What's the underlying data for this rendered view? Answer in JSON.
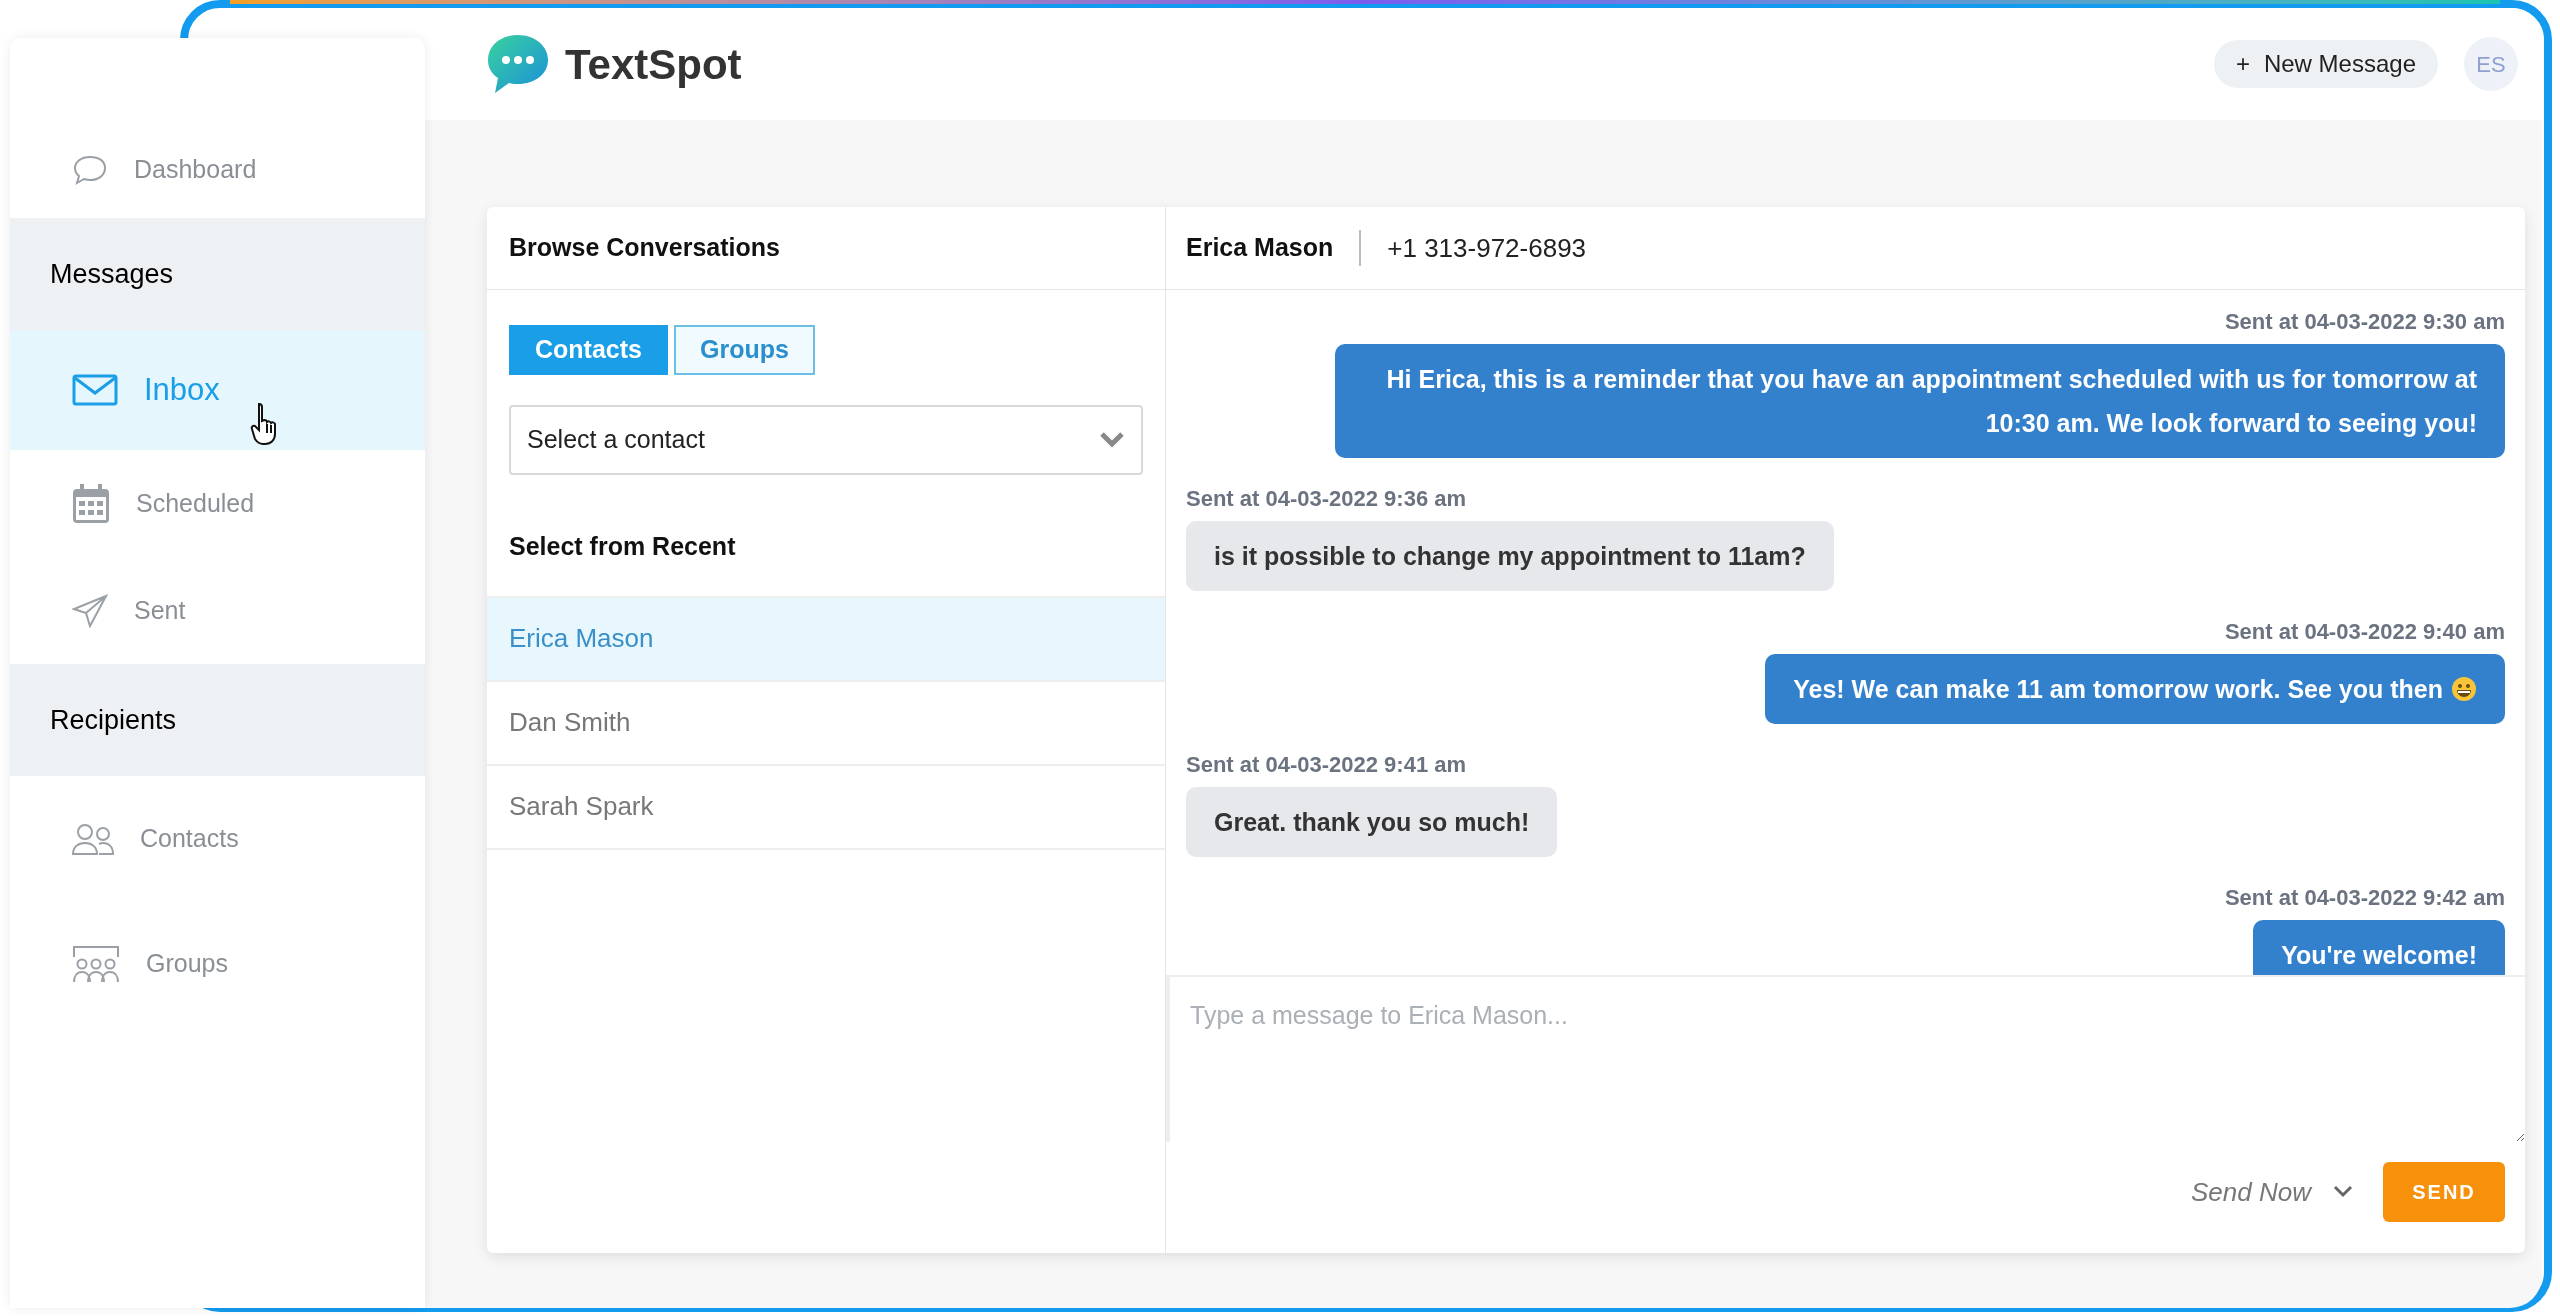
{
  "header": {
    "brand": "TextSpot",
    "new_message": {
      "icon": "+",
      "label": "New Message"
    },
    "avatar": "ES"
  },
  "sidebar": {
    "top_items": [
      {
        "label": "Dashboard",
        "selected": false
      }
    ],
    "sections": [
      {
        "title": "Messages",
        "items": [
          {
            "label": "Inbox",
            "selected": true
          },
          {
            "label": "Scheduled",
            "selected": false
          },
          {
            "label": "Sent",
            "selected": false
          }
        ]
      },
      {
        "title": "Recipients",
        "items": [
          {
            "label": "Contacts",
            "selected": false
          },
          {
            "label": "Groups",
            "selected": false
          }
        ]
      }
    ]
  },
  "conversations": {
    "title": "Browse Conversations",
    "tabs": [
      {
        "label": "Contacts",
        "selected": true
      },
      {
        "label": "Groups",
        "selected": false
      }
    ],
    "contact_select": {
      "placeholder": "Select a contact"
    },
    "recent_title": "Select from Recent",
    "recent": [
      {
        "name": "Erica Mason",
        "selected": true
      },
      {
        "name": "Dan Smith",
        "selected": false
      },
      {
        "name": "Sarah Spark",
        "selected": false
      }
    ]
  },
  "chat": {
    "contact_name": "Erica Mason",
    "phone": "+1 313-972-6893",
    "messages": [
      {
        "kind": "outgoing",
        "timestamp": "Sent at 04-03-2022 9:30 am",
        "text": "Hi Erica, this is a reminder that you have an appointment scheduled with us for tomorrow at 10:30 am. We look forward to seeing you!",
        "ends_with_emoji": false
      },
      {
        "kind": "incoming",
        "timestamp": "Sent at 04-03-2022 9:36 am",
        "text": "is it possible to change my appointment to 11am?",
        "ends_with_emoji": false
      },
      {
        "kind": "outgoing",
        "timestamp": "Sent at 04-03-2022 9:40 am",
        "text": "Yes! We can make 11 am tomorrow work. See you then",
        "ends_with_emoji": true
      },
      {
        "kind": "incoming",
        "timestamp": "Sent at 04-03-2022 9:41 am",
        "text": "Great. thank you so much!",
        "ends_with_emoji": false
      },
      {
        "kind": "outgoing",
        "timestamp": "Sent at 04-03-2022 9:42 am",
        "text": "You're welcome!",
        "ends_with_emoji": false
      }
    ],
    "composer": {
      "placeholder": "Type a message to Erica Mason...",
      "schedule": "Send Now",
      "send": "SEND"
    }
  }
}
